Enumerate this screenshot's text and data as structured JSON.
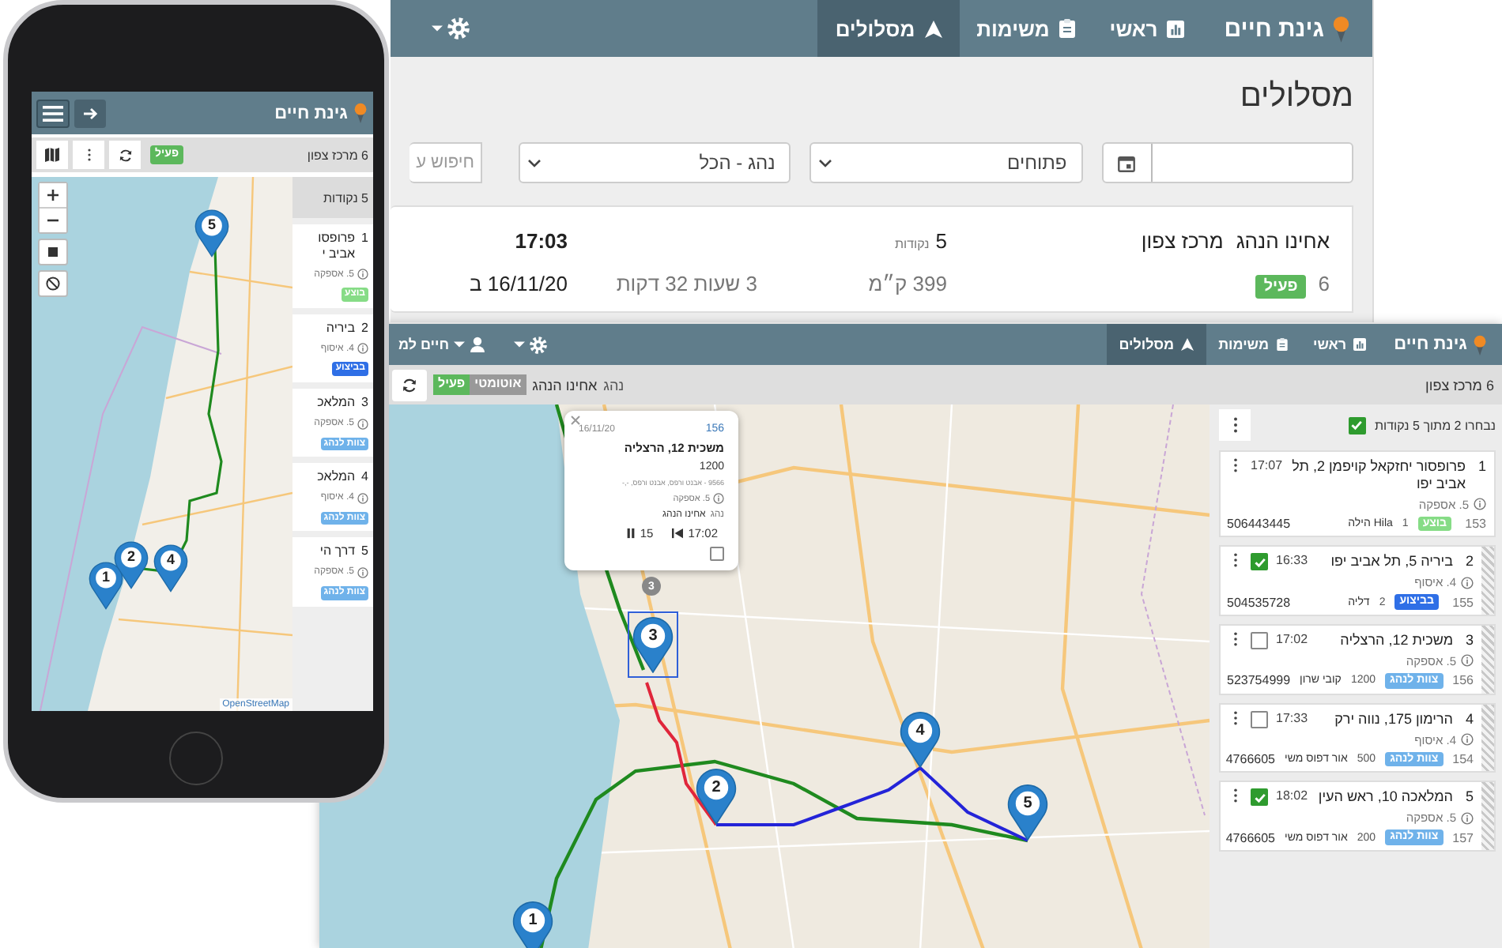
{
  "back_window": {
    "brand": "גינת חיים",
    "nav": [
      {
        "label": "ראשי",
        "selected": false
      },
      {
        "label": "משימות",
        "selected": false
      },
      {
        "label": "מסלולים",
        "selected": true
      }
    ],
    "page_title": "מסלולים",
    "filters": {
      "status": "פתוחים",
      "driver": "נהג - הכל",
      "search": {
        "placeholder": "חיפוש ע"
      }
    },
    "route": {
      "driver": "אחינו הנהג",
      "name": "מרכז צפון",
      "points": "5",
      "points_label": "נקודות",
      "time": "17:03",
      "count": "6",
      "status": "פעיל",
      "distance": "399 ק״מ",
      "duration": "3 שעות 32 דקות",
      "date": "16/11/20 ב"
    }
  },
  "phone": {
    "brand": "גינת חיים",
    "route": "6 מרכז צפון",
    "status": "פעיל",
    "pins": [
      {
        "label": "5"
      },
      {
        "label": "1"
      },
      {
        "label": "2"
      },
      {
        "label": "4"
      }
    ],
    "attribution": "OpenStreetMap",
    "list": {
      "header": "5 נקודות",
      "stops": [
        {
          "number": "1",
          "title_lines": [
            "פרופסו",
            "אביב י"
          ],
          "info": "5. אספקה",
          "tag": "בוצע",
          "color": "#86dc86"
        },
        {
          "number": "2",
          "title_lines": [
            "ביריה"
          ],
          "info": "4. איסוף",
          "tag": "בביצוע",
          "color": "#2f6fe6"
        },
        {
          "number": "3",
          "title_lines": [
            "המלאכ"
          ],
          "info": "5. אספקה",
          "tag": "צוות לנהג",
          "color": "#6fb2ea"
        },
        {
          "number": "4",
          "title_lines": [
            "המלאכ"
          ],
          "info": "4. איסוף",
          "tag": "צוות לנהג",
          "color": "#6fb2ea"
        },
        {
          "number": "5",
          "title_lines": [
            "דרך הי"
          ],
          "info": "5. אספקה",
          "tag": "צוות לנהג",
          "color": "#6fb2ea"
        }
      ]
    }
  },
  "front_window": {
    "brand": "גינת חיים",
    "nav": [
      {
        "label": "ראשי",
        "selected": false
      },
      {
        "label": "משימות",
        "selected": false
      },
      {
        "label": "מסלולים",
        "selected": true
      }
    ],
    "user": "חיים למ",
    "toolbar": {
      "route": "6 מרכז צפון",
      "driver_label": "נהג",
      "driver": "אחינו הנהג",
      "mode": "אוטומטי",
      "status": "פעיל"
    },
    "pins": [
      {
        "label": "1"
      },
      {
        "label": "2"
      },
      {
        "label": "3",
        "selected": true
      },
      {
        "label": "4"
      },
      {
        "label": "5"
      }
    ],
    "popup": {
      "id": "156",
      "date": "16/11/20",
      "title": "משכית 12, הרצליה",
      "quantity": "1200",
      "details": "9566 - אבנט ורפס, אבנט ורפס, -,-",
      "info": "5. אספקה",
      "driver_label": "נהג",
      "driver": "אחינו הנהג",
      "time": "17:02",
      "duration": "15",
      "checked": false,
      "marker": "3"
    },
    "list": {
      "summary": "נבחרו 2 מתוך 5 נקודות",
      "all_checked": true,
      "stops": [
        {
          "number": "1",
          "title": "פרופסור יחזקאל קויפמן 2, תל אביב יפו",
          "time": "17:07",
          "info": "5. אספקה",
          "id": "153",
          "tag": "בוצע",
          "color": "#86dc86",
          "quantity": "1",
          "contact": "Hila הילה",
          "phone_number": "506443445"
        },
        {
          "number": "2",
          "title": "ביריה 5, תל אביב יפו",
          "time": "16:33",
          "checked": true,
          "info": "4. איסוף",
          "id": "155",
          "tag": "בביצוע",
          "color": "#2f6fe6",
          "quantity": "2",
          "contact": "דליה",
          "phone_number": "504535728"
        },
        {
          "number": "3",
          "title": "משכית 12, הרצליה",
          "time": "17:02",
          "checked": false,
          "info": "5. אספקה",
          "id": "156",
          "tag": "צוות לנהג",
          "color": "#6fb2ea",
          "quantity": "1200",
          "contact": "קובי שרון",
          "phone_number": "523754999"
        },
        {
          "number": "4",
          "title": "הרימון 175, נווה ירק",
          "time": "17:33",
          "checked": false,
          "info": "4. איסוף",
          "id": "154",
          "tag": "צוות לנהג",
          "color": "#6fb2ea",
          "quantity": "500",
          "contact": "אור דפוס משי",
          "phone_number": "4766605"
        },
        {
          "number": "5",
          "title": "המלאכה 10, ראש העין",
          "time": "18:02",
          "checked": true,
          "info": "5. אספקה",
          "id": "157",
          "tag": "צוות לנהג",
          "color": "#6fb2ea",
          "quantity": "200",
          "contact": "אור דפוס משי",
          "phone_number": "4766605"
        }
      ]
    }
  }
}
